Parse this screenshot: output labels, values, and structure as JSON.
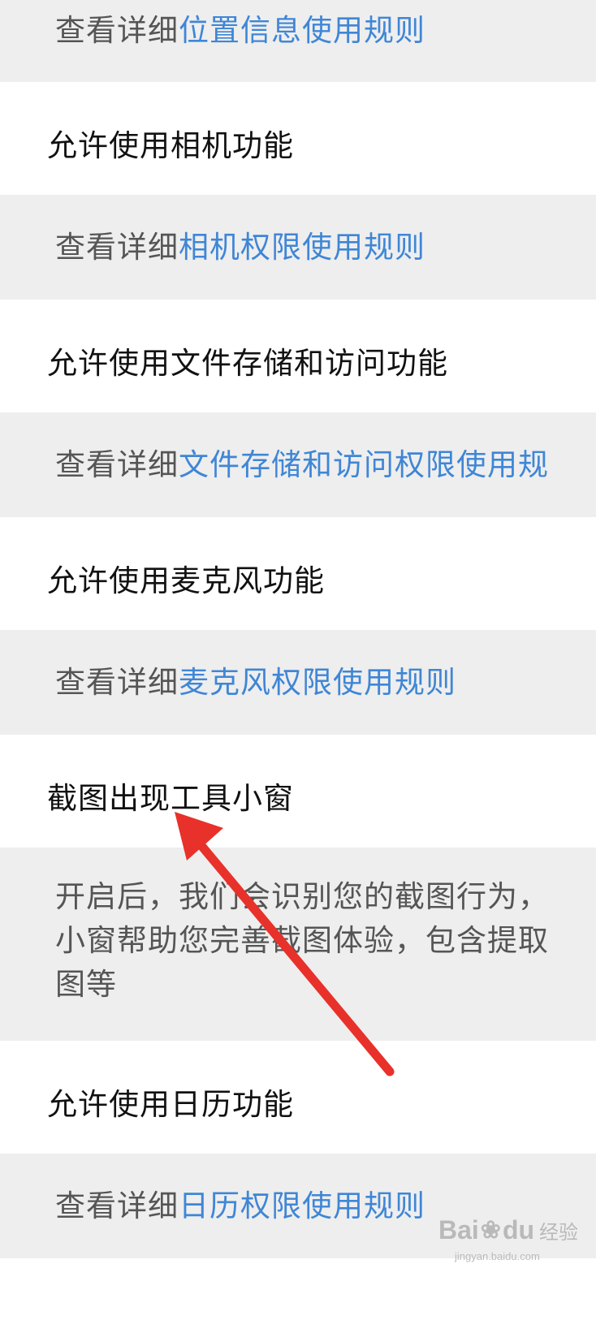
{
  "rows": [
    {
      "type": "desc",
      "prefix": "查看详细",
      "link": "位置信息使用规则"
    },
    {
      "type": "item",
      "title": "允许使用相机功能"
    },
    {
      "type": "desc",
      "prefix": "查看详细",
      "link": "相机权限使用规则"
    },
    {
      "type": "item",
      "title": "允许使用文件存储和访问功能"
    },
    {
      "type": "desc",
      "prefix": "查看详细",
      "link": "文件存储和访问权限使用规"
    },
    {
      "type": "item",
      "title": "允许使用麦克风功能"
    },
    {
      "type": "desc",
      "prefix": "查看详细",
      "link": "麦克风权限使用规则"
    },
    {
      "type": "item",
      "title": "截图出现工具小窗"
    },
    {
      "type": "desc_multi",
      "lines": [
        "开启后，我们会识别您的截图行为，",
        "小窗帮助您完善截图体验，包含提取",
        "图等"
      ]
    },
    {
      "type": "item",
      "title": "允许使用日历功能"
    },
    {
      "type": "desc",
      "prefix": "查看详细",
      "link": "日历权限使用规则"
    }
  ],
  "watermark": {
    "brand_left": "Bai",
    "brand_right": "du",
    "product": "经验",
    "url": "jingyan.baidu.com"
  },
  "colors": {
    "link": "#3f86d6",
    "arrow": "#e8312a",
    "desc_bg": "#eeeeee"
  }
}
